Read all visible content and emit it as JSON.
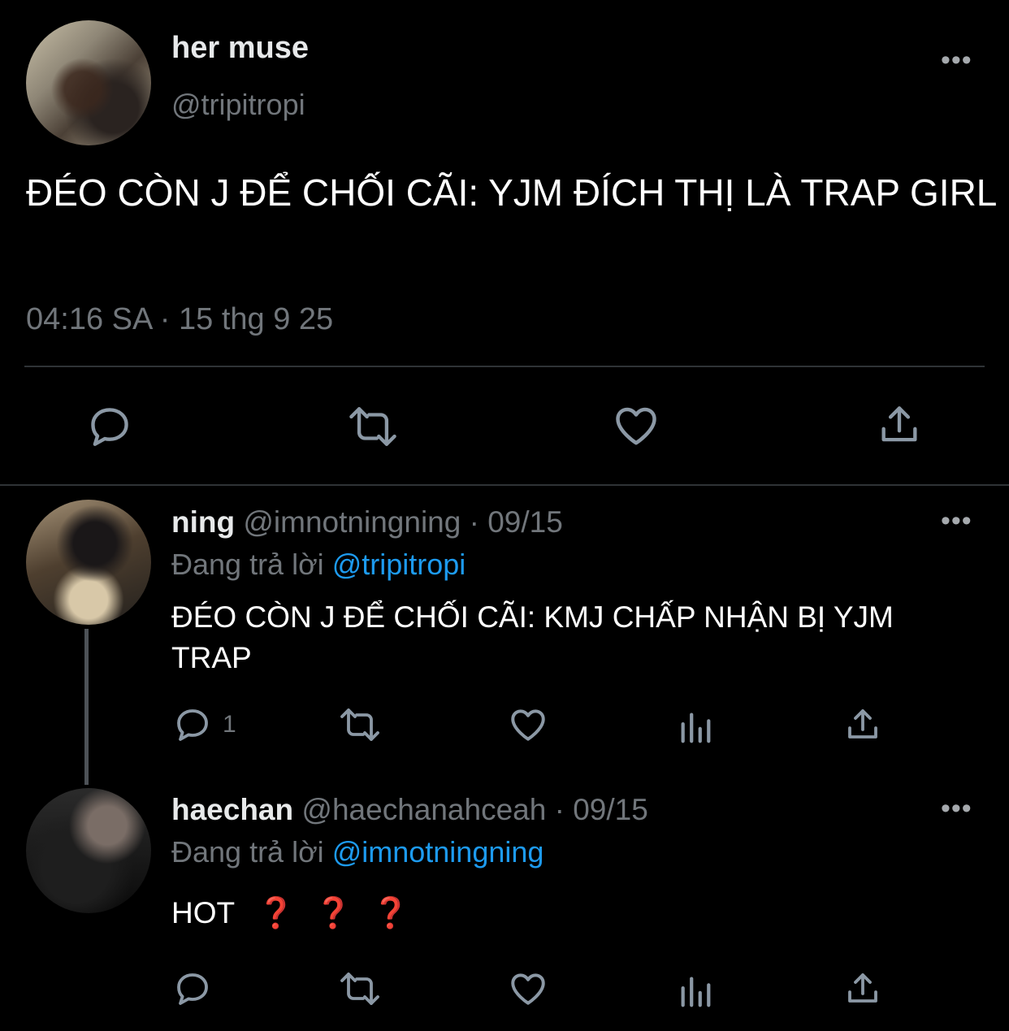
{
  "main_tweet": {
    "display_name": "her muse",
    "handle": "@tripitropi",
    "text": "ĐÉO CÒN J ĐỂ CHỐI CÃI: YJM ĐÍCH THỊ LÀ TRAP GIRL",
    "timestamp": "04:16 SA · 15 thg 9 25",
    "actions": [
      "reply-icon",
      "retweet-icon",
      "like-icon",
      "share-icon"
    ]
  },
  "replies": [
    {
      "display_name": "ning",
      "handle": "@imnotningning",
      "date": "· 09/15",
      "replying_prefix": "Đang trả lời",
      "replying_to": "@tripitropi",
      "text": "ĐÉO CÒN J ĐỂ CHỐI CÃI: KMJ CHẤP NHẬN BỊ YJM TRAP",
      "reply_count": "1"
    },
    {
      "display_name": "haechan",
      "handle": "@haechanahceah",
      "date": "· 09/15",
      "replying_prefix": "Đang trả lời",
      "replying_to": "@imnotningning",
      "text": "HOT",
      "emoji": [
        "❓",
        "❓",
        "❓"
      ]
    }
  ],
  "more_glyph": "•••",
  "colors": {
    "background": "#000000",
    "primary_text": "#e7e9ea",
    "muted_text": "#71767b",
    "link": "#1d9bf0",
    "divider": "#2f3336",
    "emoji_red": "#d21f1f"
  }
}
